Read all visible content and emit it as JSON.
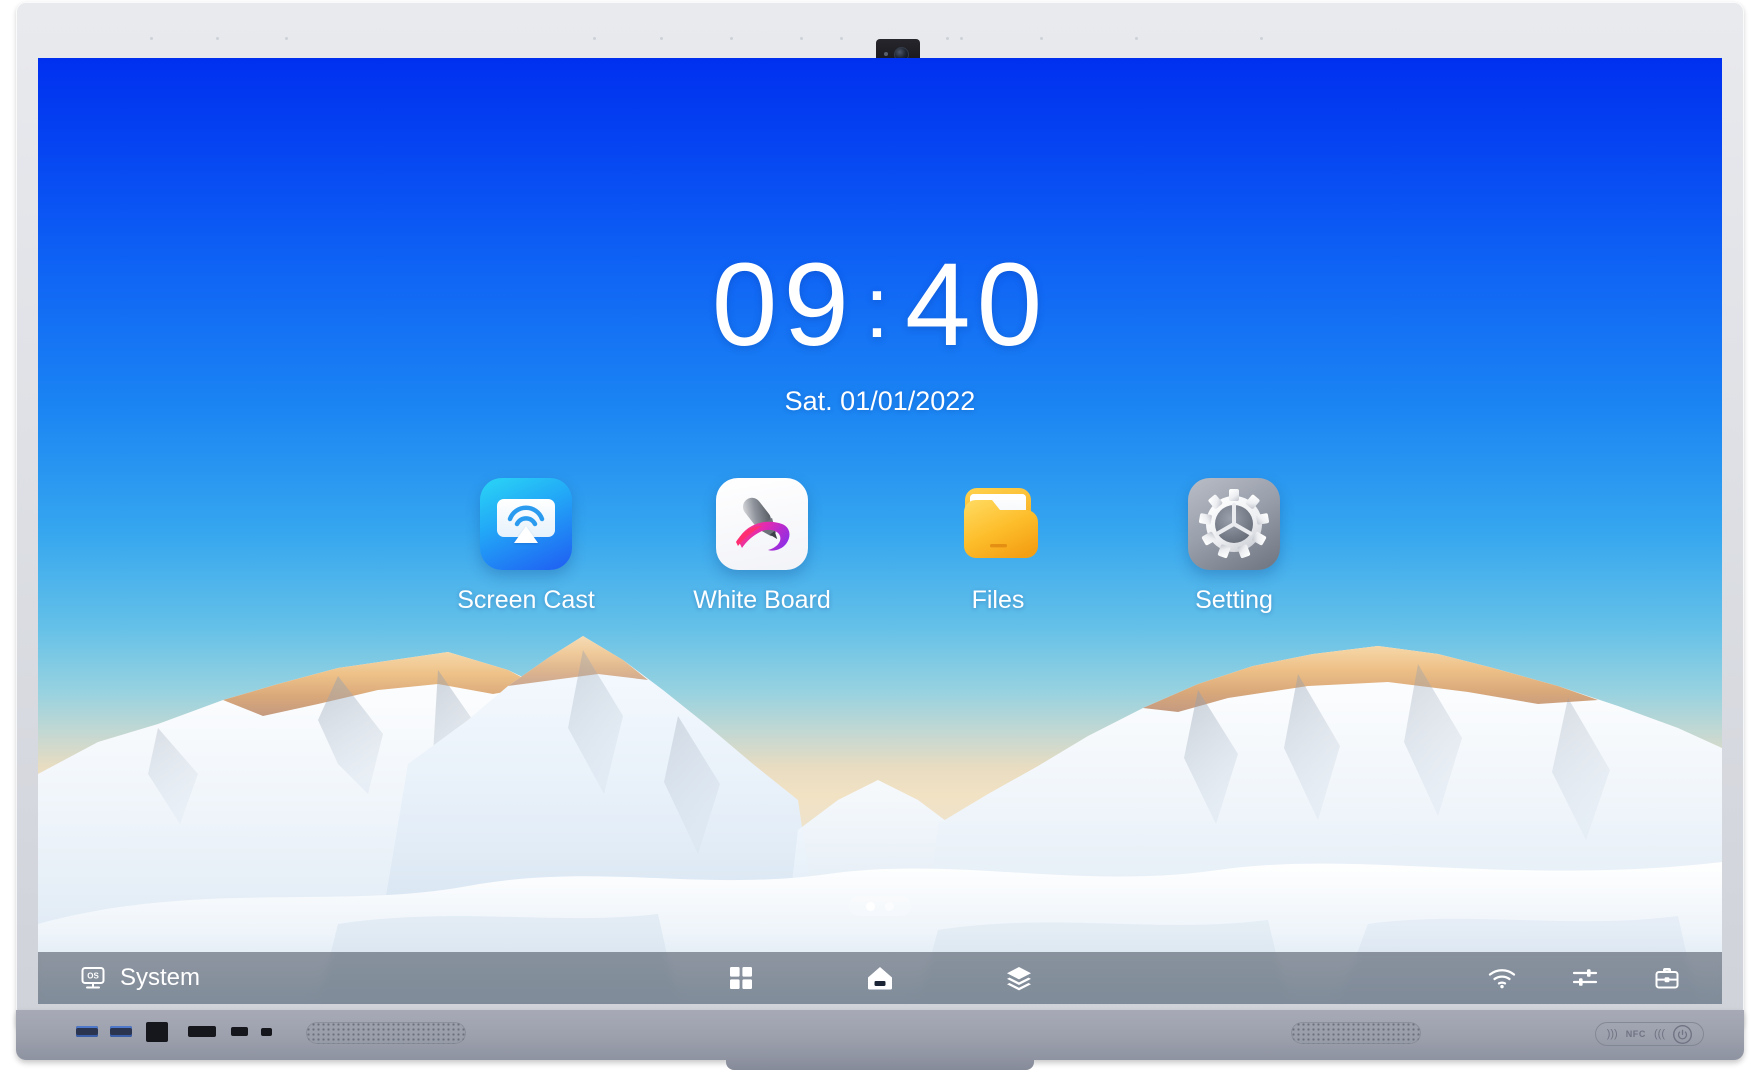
{
  "device": {
    "name": "interactive-flat-panel",
    "camera_label": "camera-module",
    "nfc_label": "NFC",
    "power_label": "power-button"
  },
  "home": {
    "clock": {
      "hours": "09",
      "separator": ":",
      "minutes": "40",
      "date": "Sat. 01/01/2022"
    },
    "apps": [
      {
        "label": "Screen Cast",
        "icon": "screen-cast-icon"
      },
      {
        "label": "White Board",
        "icon": "white-board-icon"
      },
      {
        "label": "Files",
        "icon": "files-folder-icon"
      },
      {
        "label": "Setting",
        "icon": "settings-gear-icon"
      }
    ],
    "pager": {
      "pages": 2,
      "active_page": 1
    }
  },
  "taskbar": {
    "os_label": "System",
    "os_icon": "os-monitor-icon",
    "center_items": [
      {
        "label": "Apps",
        "icon": "apps-grid-icon"
      },
      {
        "label": "Home",
        "icon": "home-icon"
      },
      {
        "label": "Recents",
        "icon": "layers-icon"
      }
    ],
    "right_items": [
      {
        "label": "Wi-Fi",
        "icon": "wifi-icon"
      },
      {
        "label": "Quick Settings",
        "icon": "sliders-icon"
      },
      {
        "label": "Tools",
        "icon": "toolbox-icon"
      }
    ]
  },
  "colors": {
    "sky_top": "#0030ef",
    "sky_mid": "#35a6ef",
    "sky_horizon": "#ece3cd",
    "accent_blue": "#1f7ff5",
    "taskbar": "rgba(18,26,40,0.42)",
    "bezel": "#dfe1e6",
    "chin": "#9ca0ad"
  }
}
